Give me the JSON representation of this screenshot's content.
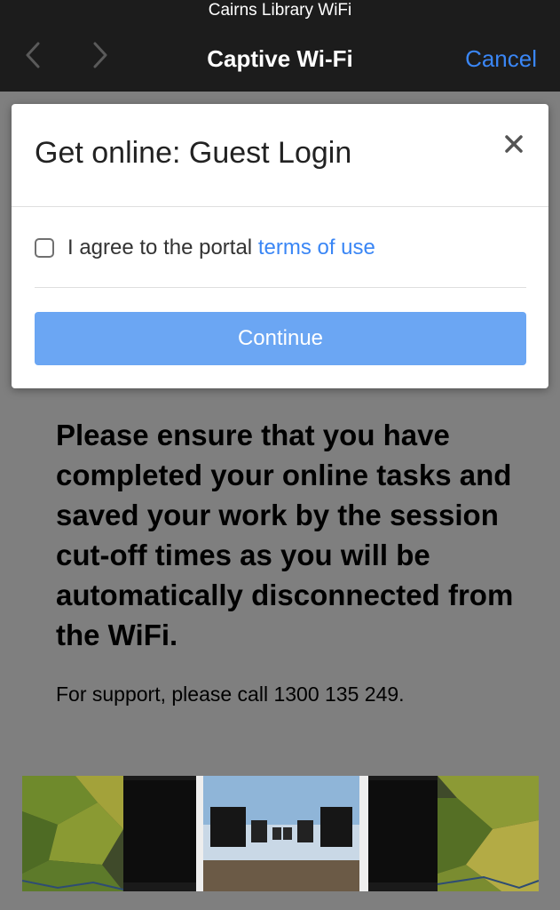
{
  "status_bar": {
    "network_name": "Cairns Library WiFi"
  },
  "nav": {
    "back_icon": "chevron-left-icon",
    "forward_icon": "chevron-right-icon",
    "title": "Captive Wi-Fi",
    "cancel_label": "Cancel"
  },
  "modal": {
    "title": "Get online: Guest Login",
    "close_icon": "close-icon",
    "agree_prefix": "I agree to the portal",
    "terms_link": "terms of use",
    "checkbox_checked": false,
    "continue_label": "Continue"
  },
  "page": {
    "notice": "Please ensure that you have completed your online tasks and saved your work by the session cut-off times as you will be automatically disconnected from the WiFi.",
    "support": "For support, please call 1300 135 249."
  },
  "colors": {
    "accent": "#3a86f5",
    "continue_button": "#6ba6f3",
    "nav_background": "#1c1c1c",
    "overlay": "#7f7f7f"
  }
}
